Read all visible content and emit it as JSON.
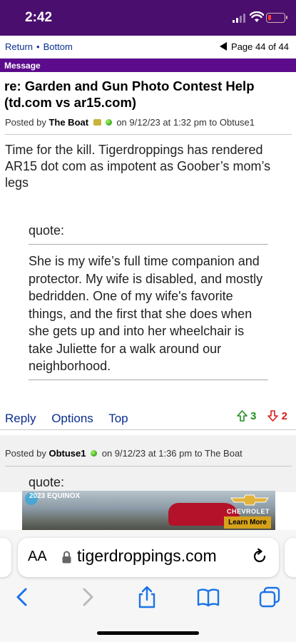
{
  "status": {
    "time": "2:42"
  },
  "nav": {
    "return": "Return",
    "separator": "•",
    "bottom": "Bottom",
    "page": "Page 44 of 44"
  },
  "message_label": "Message",
  "post": {
    "title": "re: Garden and Gun Photo Contest Help (td.com vs ar15.com)",
    "posted_prefix": "Posted by",
    "author": "The Boat",
    "posted_on": "on 9/12/23 at 1:32 pm to Obtuse1",
    "body": "Time for the kill. Tigerdroppings has rendered AR15 dot com as impotent as Goober’s mom’s legs",
    "quote_label": "quote:",
    "quote_text": "She is my wife’s full time companion and protector. My wife is disabled, and mostly bedridden. One of my wife's favorite things, and the first that she does when she gets up and into her wheelchair is take Juliette for a walk around our neighborhood.",
    "actions": {
      "reply": "Reply",
      "options": "Options",
      "top": "Top"
    },
    "upvotes": "3",
    "downvotes": "2"
  },
  "post2": {
    "posted_prefix": "Posted by",
    "author": "Obtuse1",
    "posted_on": "on 9/12/23 at 1:36 pm to The Boat",
    "quote_label": "quote:"
  },
  "ad": {
    "label": "2023 EQUINOX",
    "brand": "CHEVROLET",
    "cta": "Learn More"
  },
  "browser": {
    "aa": "AA",
    "url": "tigerdroppings.com"
  },
  "colors": {
    "header_purple": "#4a0f6e",
    "message_bar": "#5b0b8c",
    "link_blue": "#0b2e8f",
    "up_green": "#1e8e1e",
    "down_red": "#d81b1b"
  },
  "icons": [
    "signal-icon",
    "wifi-icon",
    "battery-icon",
    "back-triangle-icon",
    "thumbs-up-arrow-icon",
    "thumbs-down-arrow-icon",
    "lock-icon",
    "reload-icon",
    "back-chevron-icon",
    "forward-chevron-icon",
    "share-icon",
    "bookmarks-icon",
    "tabs-icon"
  ]
}
